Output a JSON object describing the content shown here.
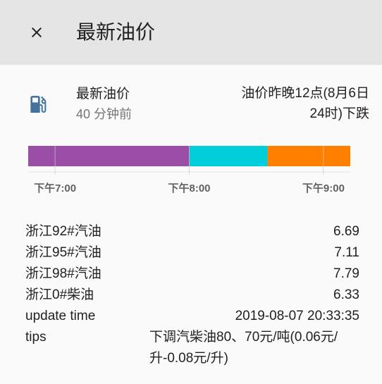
{
  "header": {
    "title": "最新油价",
    "close_icon": "close-icon"
  },
  "entity": {
    "icon": "gas-station-icon",
    "name": "最新油价",
    "last_changed": "40 分钟前",
    "state": "油价昨晚12点(8月6日24时)下跌"
  },
  "timeline": {
    "segments": [
      {
        "color": "#9b4ea6",
        "start": "19:00",
        "end": "20:00"
      },
      {
        "color": "#00ced8",
        "start": "20:00",
        "end": "20:35"
      },
      {
        "color": "#ff7f00",
        "start": "20:35",
        "end": "21:00"
      }
    ],
    "ticks": [
      "下午7:00",
      "下午8:00",
      "下午9:00"
    ]
  },
  "attributes": [
    {
      "name": "浙江92#汽油",
      "value": "6.69"
    },
    {
      "name": "浙江95#汽油",
      "value": "7.11"
    },
    {
      "name": "浙江98#汽油",
      "value": "7.79"
    },
    {
      "name": "浙江0#柴油",
      "value": "6.33"
    },
    {
      "name": "update time",
      "value": "2019-08-07 20:33:35"
    },
    {
      "name": "tips",
      "value": "下调汽柴油80、70元/吨(0.06元/升-0.08元/升)"
    }
  ]
}
